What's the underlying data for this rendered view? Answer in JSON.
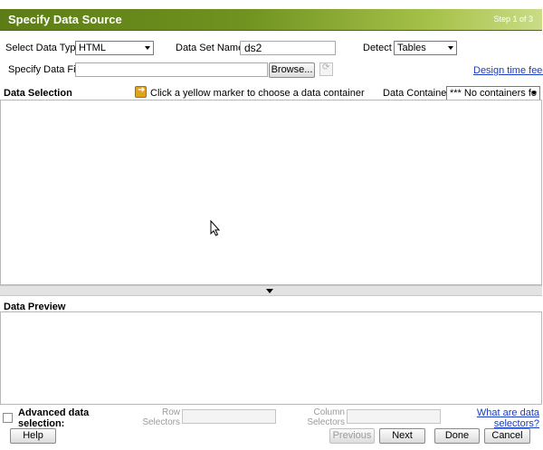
{
  "dialog": {
    "title": "Specify Data Source",
    "step": "Step 1 of 3"
  },
  "form": {
    "data_type_label": "Select Data Type",
    "data_type_value": "HTML",
    "dataset_name_label": "Data Set Name",
    "dataset_name_value": "ds2",
    "detect_label": "Detect",
    "detect_value": "Tables",
    "data_file_label": "Specify Data File",
    "data_file_value": "",
    "browse_label": "Browse...",
    "design_time_feed_label": "Design time feed"
  },
  "data_selection": {
    "heading": "Data Selection",
    "hint": "Click a yellow marker to choose a data container",
    "containers_label": "Data Containers",
    "containers_value": "*** No containers fo"
  },
  "data_preview": {
    "heading": "Data Preview"
  },
  "advanced": {
    "checkbox_label": "Advanced data selection:",
    "row_selectors_label": "Row Selectors",
    "column_selectors_label": "Column Selectors",
    "help_link": "What are data selectors?"
  },
  "footer": {
    "help": "Help",
    "previous": "Previous",
    "next": "Next",
    "done": "Done",
    "cancel": "Cancel"
  }
}
